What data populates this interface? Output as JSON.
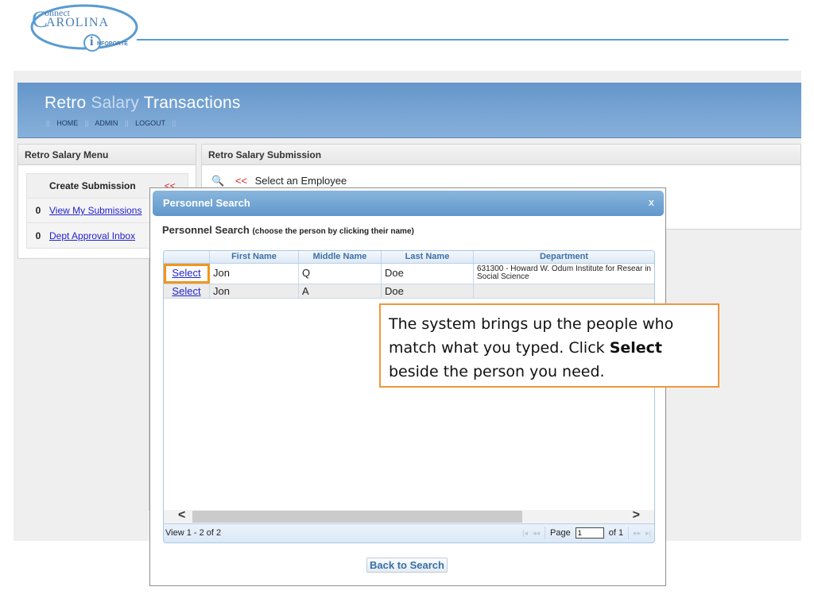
{
  "logo": {
    "line1": "onnect",
    "line2": "AROLINA",
    "initial": "C",
    "sub_initial": "i",
    "sub": "NFOPORTE"
  },
  "banner": {
    "title_part1": "Retro",
    "title_part2": "Salary",
    "title_part3": "Transactions",
    "nav": [
      {
        "label": "HOME"
      },
      {
        "label": "ADMIN"
      },
      {
        "label": "LOGOUT"
      }
    ],
    "separator": "||"
  },
  "menu": {
    "title": "Retro Salary Menu",
    "create_label": "Create Submission",
    "create_arrows": "<<",
    "items": [
      {
        "count": "0",
        "label": "View My Submissions"
      },
      {
        "count": "0",
        "label": "Dept Approval Inbox"
      }
    ]
  },
  "submission": {
    "title": "Retro Salary Submission",
    "search_icon": "magnifier-icon",
    "arrows": "<<",
    "prompt": "Select an Employee"
  },
  "dialog": {
    "title": "Personnel Search",
    "close": "x",
    "heading": "Personnel Search",
    "hint": "(choose the person by clicking their name)",
    "columns": [
      "",
      "First Name",
      "Middle Name",
      "Last Name",
      "Department"
    ],
    "rows": [
      {
        "action": "Select",
        "first": "Jon",
        "middle": "Q",
        "last": "Doe",
        "department": "631300 - Howard W. Odum Institute for Resear in Social Science",
        "highlighted": true
      },
      {
        "action": "Select",
        "first": "Jon",
        "middle": "A",
        "last": "Doe",
        "department": "",
        "highlighted": false
      }
    ],
    "scroll_left": "<",
    "scroll_right": ">",
    "view_count": "View 1 - 2 of 2",
    "pager": {
      "first": "|◂",
      "prev": "◂◂",
      "page_label": "Page",
      "page_value": "1",
      "of_label": "of 1",
      "next": "▸▸",
      "last": "▸|"
    },
    "back_button": "Back to Search"
  },
  "callout": {
    "text_before": "The system brings up the people who match what you typed.  Click ",
    "bold": "Select",
    "text_after": " beside the person you need.",
    "border_color": "#f0963c"
  }
}
